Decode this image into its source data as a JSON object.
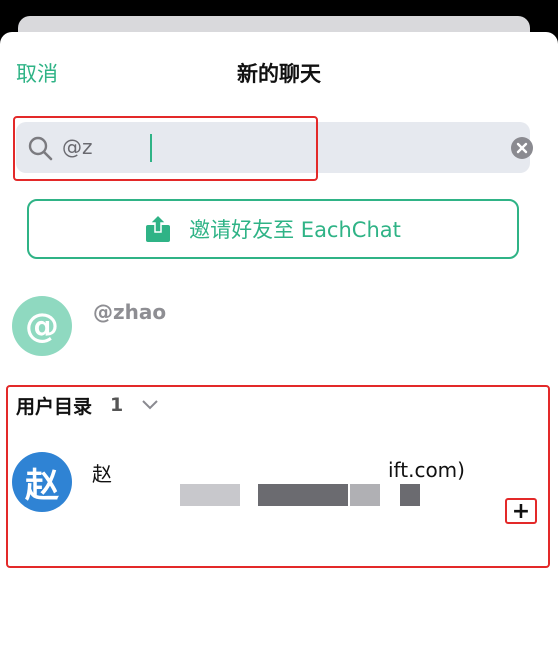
{
  "header": {
    "cancel_label": "取消",
    "title": "新的聊天"
  },
  "search": {
    "value": "@z",
    "clear_icon": "clear-icon",
    "icon": "search-icon"
  },
  "invite": {
    "label": "邀请好友至 EachChat",
    "icon": "share-upload-icon"
  },
  "at_result": {
    "avatar_letter": "@",
    "name": "@zhao"
  },
  "directory": {
    "title": "用户目录",
    "count": "1",
    "users": [
      {
        "avatar_letter": "赵",
        "name_visible": "赵",
        "name_tail": "ift.com)"
      }
    ],
    "add_label": "+"
  },
  "colors": {
    "accent": "#2fb386",
    "highlight": "#e32929",
    "user_avatar": "#2f83d4",
    "at_avatar": "#8fd9c0"
  }
}
